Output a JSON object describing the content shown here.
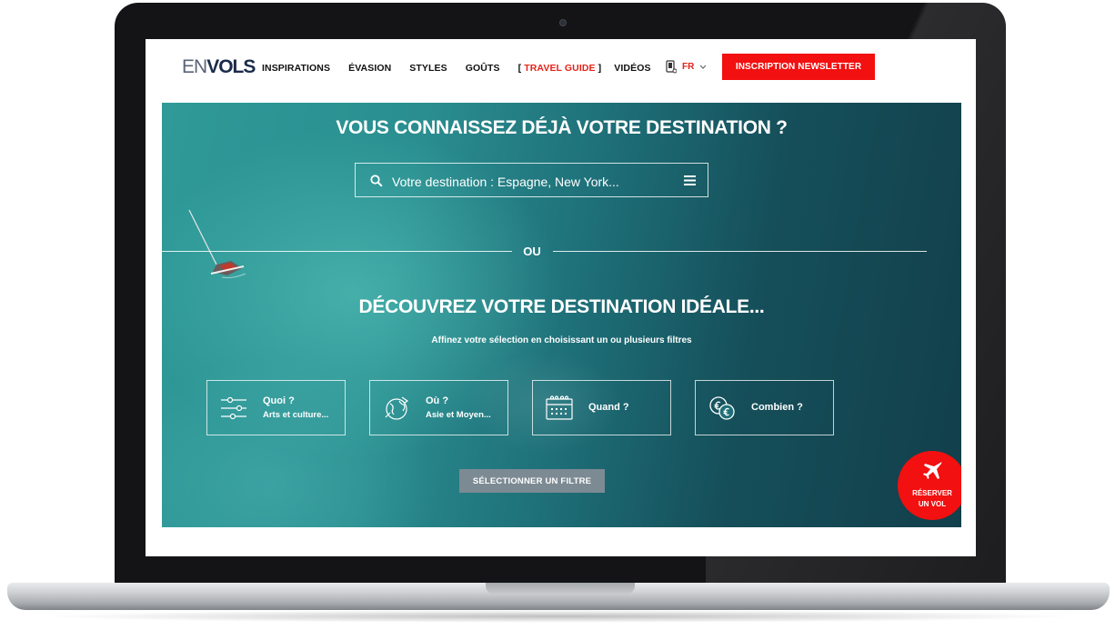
{
  "header": {
    "logo": {
      "part1": "EN",
      "part2": "VOLS"
    },
    "nav": [
      "INSPIRATIONS",
      "ÉVASION",
      "STYLES",
      "GOÛTS"
    ],
    "travel_guide": {
      "open": "[",
      "label": "TRAVEL GUIDE",
      "close": "]"
    },
    "videos": "VIDÉOS",
    "language": "FR",
    "newsletter_button": "INSCRIPTION NEWSLETTER"
  },
  "hero": {
    "title": "VOUS CONNAISSEZ DÉJÀ VOTRE DESTINATION ?",
    "search": {
      "placeholder": "Votre destination : Espagne, New York..."
    },
    "separator": "OU",
    "title2": "DÉCOUVREZ VOTRE DESTINATION IDÉALE...",
    "subtitle": "Affinez votre sélection en choisissant un ou plusieurs filtres",
    "filters": {
      "what": {
        "label": "Quoi ?",
        "value": "Arts et culture..."
      },
      "where": {
        "label": "Où ?",
        "value": "Asie et Moyen..."
      },
      "when": {
        "label": "Quand ?"
      },
      "budget": {
        "label": "Combien ?"
      }
    },
    "select_button": "SÉLECTIONNER UN FILTRE",
    "reserve": {
      "line1": "RÉSERVER",
      "line2": "UN VOL"
    }
  },
  "colors": {
    "accent": "#f21010",
    "sea_light": "#2f9a98",
    "sea_dark": "#123f4b",
    "button_grey": "#7c8a93"
  },
  "icons": [
    "phone-icon",
    "chevron-down-icon",
    "search-icon",
    "menu-icon",
    "sliders-icon",
    "globe-icon",
    "calendar-icon",
    "coins-icon",
    "airplane-icon"
  ]
}
